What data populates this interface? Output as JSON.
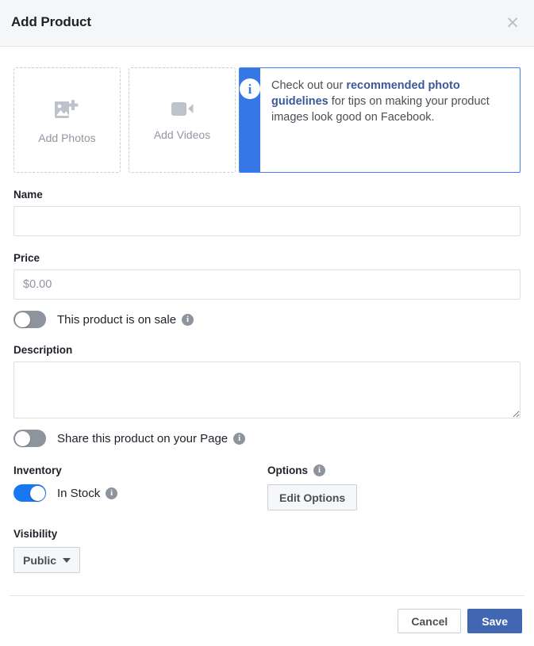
{
  "dialog": {
    "title": "Add Product",
    "close_icon": "close-icon"
  },
  "media": {
    "photos": {
      "label": "Add Photos",
      "icon": "add-photo-icon"
    },
    "videos": {
      "label": "Add Videos",
      "icon": "add-video-icon"
    },
    "callout": {
      "icon": "info-circle-icon",
      "text_before": "Check out our ",
      "link_text": "recommended photo guidelines",
      "text_after": " for tips on making your product images look good on Facebook.",
      "strip_color": "#3578e5",
      "link_color": "#3b5998"
    }
  },
  "form": {
    "name": {
      "label": "Name",
      "value": "",
      "placeholder": ""
    },
    "price": {
      "label": "Price",
      "value": "",
      "placeholder": "$0.00"
    },
    "on_sale": {
      "label": "This product is on sale",
      "state": "off",
      "info_icon": "info-icon"
    },
    "description": {
      "label": "Description",
      "value": "",
      "placeholder": ""
    },
    "share_on_page": {
      "label": "Share this product on your Page",
      "state": "off",
      "info_icon": "info-icon"
    },
    "inventory": {
      "label": "Inventory",
      "toggle_label": "In Stock",
      "state": "on",
      "info_icon": "info-icon",
      "on_color": "#1877f2"
    },
    "options": {
      "label": "Options",
      "info_icon": "info-icon",
      "button_label": "Edit Options"
    },
    "visibility": {
      "label": "Visibility",
      "selected": "Public",
      "caret_icon": "chevron-down-icon"
    }
  },
  "footer": {
    "cancel_label": "Cancel",
    "save_label": "Save",
    "save_color": "#4267b2"
  }
}
